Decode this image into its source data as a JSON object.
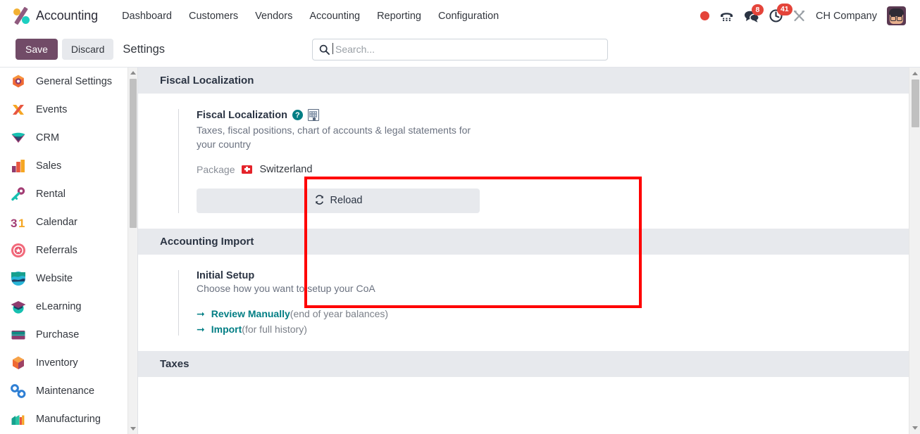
{
  "navbar": {
    "logo_icon": "odoo-logo-icon",
    "brand": "Accounting",
    "menu": [
      {
        "label": "Dashboard"
      },
      {
        "label": "Customers"
      },
      {
        "label": "Vendors"
      },
      {
        "label": "Accounting"
      },
      {
        "label": "Reporting"
      },
      {
        "label": "Configuration"
      }
    ],
    "status_dot_icon": "red-status-dot-icon",
    "phone_icon": "phone-dialpad-icon",
    "messages_icon": "chat-bubble-icon",
    "messages_badge": "8",
    "activities_icon": "clock-activity-icon",
    "activities_badge": "41",
    "tools_icon": "tools-wrench-icon",
    "company": "CH Company",
    "avatar_icon": "user-avatar-icon"
  },
  "control_panel": {
    "save_label": "Save",
    "discard_label": "Discard",
    "title": "Settings",
    "search_icon": "search-icon",
    "search_value": "",
    "search_placeholder": "Search..."
  },
  "sidebar": {
    "items": [
      {
        "label": "General Settings",
        "icon": "settings-gear-icon"
      },
      {
        "label": "Events",
        "icon": "events-icon"
      },
      {
        "label": "CRM",
        "icon": "crm-icon"
      },
      {
        "label": "Sales",
        "icon": "sales-icon"
      },
      {
        "label": "Rental",
        "icon": "rental-key-icon"
      },
      {
        "label": "Calendar",
        "icon": "calendar-31-icon"
      },
      {
        "label": "Referrals",
        "icon": "referrals-icon"
      },
      {
        "label": "Website",
        "icon": "website-icon"
      },
      {
        "label": "eLearning",
        "icon": "elearning-icon"
      },
      {
        "label": "Purchase",
        "icon": "purchase-icon"
      },
      {
        "label": "Inventory",
        "icon": "inventory-icon"
      },
      {
        "label": "Maintenance",
        "icon": "maintenance-icon"
      },
      {
        "label": "Manufacturing",
        "icon": "manufacturing-icon"
      }
    ]
  },
  "sections": {
    "fiscal_localization": {
      "header": "Fiscal Localization",
      "card": {
        "title": "Fiscal Localization",
        "help_icon": "help-question-icon",
        "company_icon": "building-company-icon",
        "description": "Taxes, fiscal positions, chart of accounts & legal statements for your country",
        "package_label": "Package",
        "package_flag_icon": "flag-switzerland-icon",
        "package_value": "Switzerland",
        "reload_icon": "refresh-icon",
        "reload_label": "Reload"
      }
    },
    "accounting_import": {
      "header": "Accounting Import",
      "card": {
        "title": "Initial Setup",
        "description": "Choose how you want to setup your CoA",
        "links": [
          {
            "arrow_icon": "arrow-right-icon",
            "label": "Review Manually",
            "note": "(end of year balances)"
          },
          {
            "arrow_icon": "arrow-right-icon",
            "label": "Import",
            "note": "(for full history)"
          }
        ]
      }
    },
    "taxes": {
      "header": "Taxes"
    }
  },
  "colors": {
    "brand_purple": "#714b67",
    "accent_teal": "#017e84",
    "badge_red": "#e4443a",
    "highlight_red": "#ff0000",
    "section_header_bg": "#e7e9ed"
  }
}
